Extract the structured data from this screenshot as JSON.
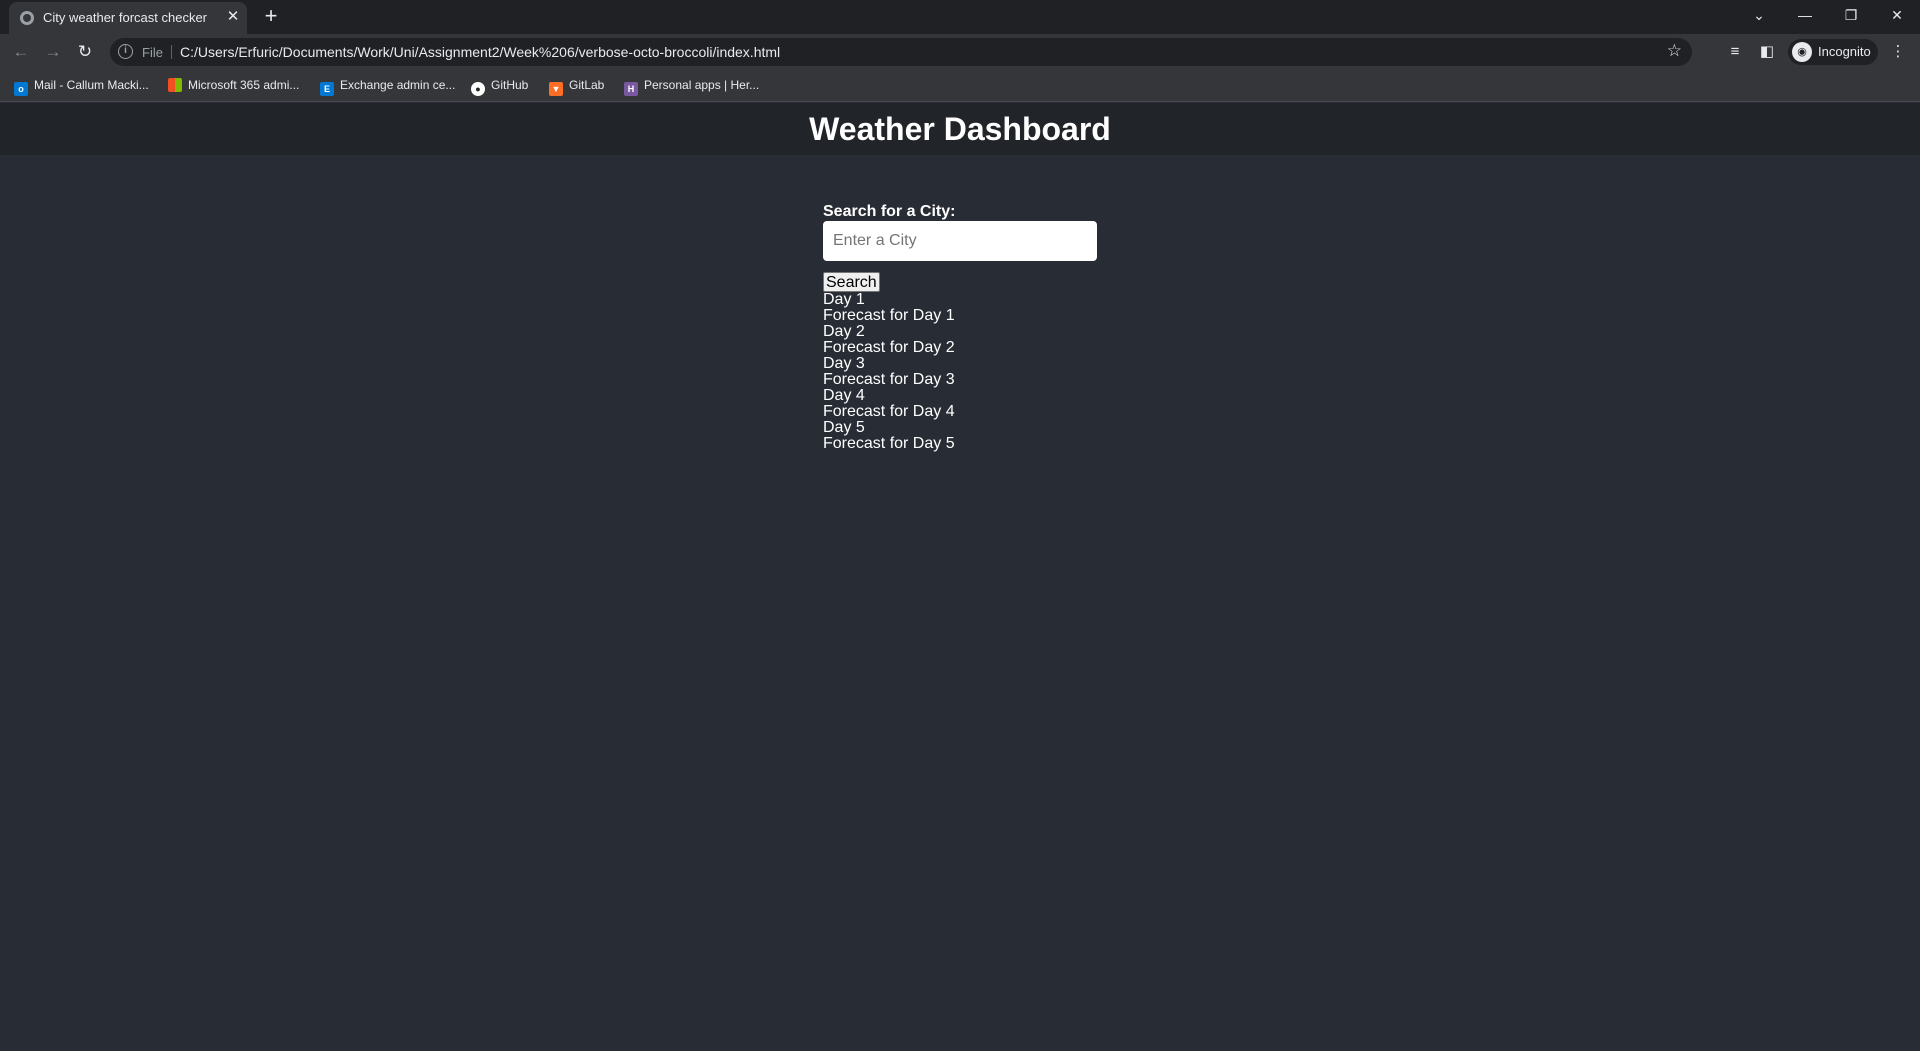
{
  "browser": {
    "tab_title": "City weather forcast checker",
    "url_scheme_label": "File",
    "url": "C:/Users/Erfuric/Documents/Work/Uni/Assignment2/Week%206/verbose-octo-broccoli/index.html",
    "profile_label": "Incognito",
    "bookmarks": [
      {
        "label": "Mail - Callum Macki...",
        "icon": "outlook-icon",
        "color": "#0078d4"
      },
      {
        "label": "Microsoft 365 admi...",
        "icon": "microsoft-icon",
        "color": "#f25022"
      },
      {
        "label": "Exchange admin ce...",
        "icon": "exchange-icon",
        "color": "#0078d4"
      },
      {
        "label": "GitHub",
        "icon": "github-icon",
        "color": "#ffffff"
      },
      {
        "label": "GitLab",
        "icon": "gitlab-icon",
        "color": "#fc6d26"
      },
      {
        "label": "Personal apps | Her...",
        "icon": "heroku-icon",
        "color": "#79589f"
      }
    ]
  },
  "page": {
    "title": "Weather Dashboard",
    "search_label": "Search for a City:",
    "search_placeholder": "Enter a City",
    "search_button": "Search",
    "forecast": [
      {
        "day": "Day 1",
        "text": "Forecast for Day 1"
      },
      {
        "day": "Day 2",
        "text": "Forecast for Day 2"
      },
      {
        "day": "Day 3",
        "text": "Forecast for Day 3"
      },
      {
        "day": "Day 4",
        "text": "Forecast for Day 4"
      },
      {
        "day": "Day 5",
        "text": "Forecast for Day 5"
      }
    ]
  },
  "colors": {
    "page_background": "#282c34",
    "header_background": "#212428"
  }
}
